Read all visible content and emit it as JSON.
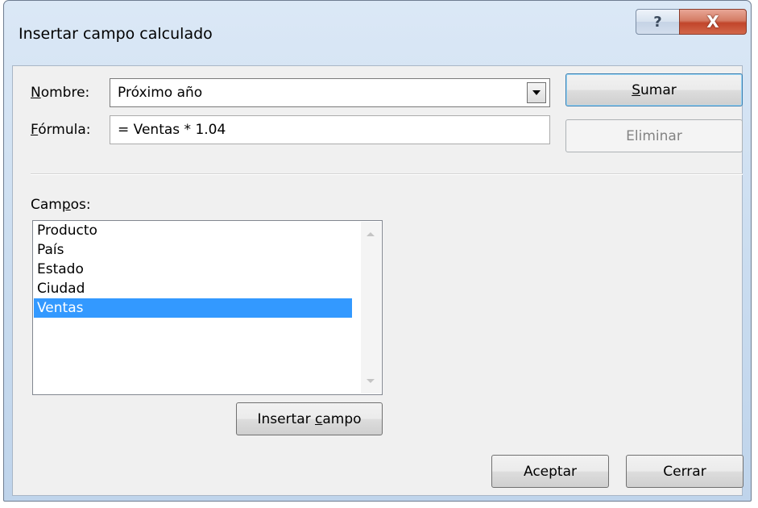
{
  "window": {
    "title": "Insertar campo calculado",
    "help_glyph": "?",
    "close_glyph": "X"
  },
  "nombre": {
    "label_underlined": "N",
    "label_rest": "ombre:",
    "value": "Próximo año"
  },
  "formula": {
    "label_underlined": "F",
    "label_rest": "órmula:",
    "value": "= Ventas * 1.04"
  },
  "buttons": {
    "sumar_underlined": "S",
    "sumar_rest": "umar",
    "eliminar": "Eliminar",
    "insertar_prefix": "Insertar ",
    "insertar_underlined": "c",
    "insertar_rest": "ampo",
    "aceptar": "Aceptar",
    "cerrar": "Cerrar"
  },
  "campos": {
    "label_prefix": "Cam",
    "label_underlined": "p",
    "label_rest": "os:",
    "items": [
      "Producto",
      "País",
      "Estado",
      "Ciudad",
      "Ventas"
    ],
    "selected": "Ventas"
  }
}
